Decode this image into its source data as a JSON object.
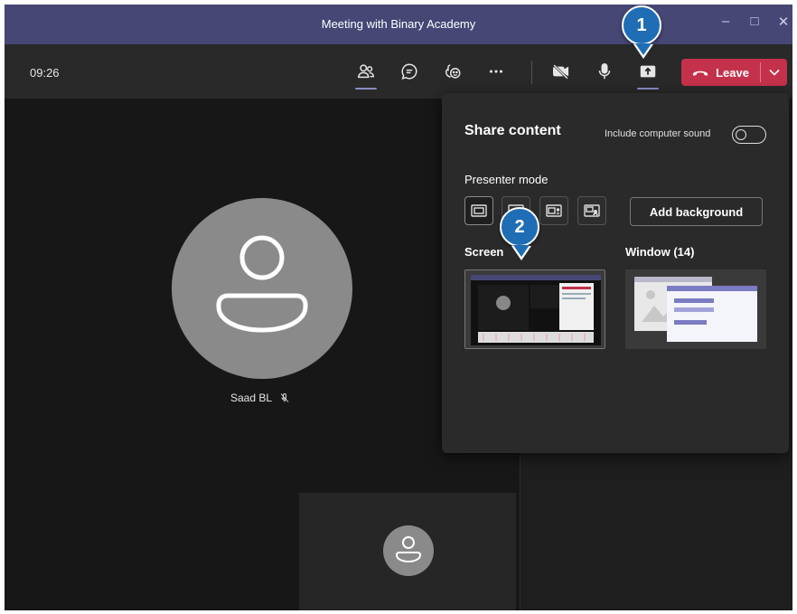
{
  "window": {
    "title": "Meeting with Binary Academy"
  },
  "toolbar": {
    "time": "09:26",
    "leave_label": "Leave"
  },
  "icons": [
    "people-icon",
    "chat-icon",
    "reactions-icon",
    "more-icon",
    "camera-off-icon",
    "mic-icon",
    "share-icon",
    "phone-icon",
    "chevron-down-icon"
  ],
  "participant": {
    "name": "Saad BL"
  },
  "share_panel": {
    "title": "Share content",
    "include_sound_label": "Include computer sound",
    "presenter_mode_label": "Presenter mode",
    "add_background_label": "Add background",
    "screen_label": "Screen",
    "window_label": "Window (14)"
  },
  "callouts": {
    "one": "1",
    "two": "2"
  },
  "colors": {
    "titlebar": "#464775",
    "leave": "#c4314b",
    "callout": "#1f6db5",
    "accent": "#8b8cc7"
  }
}
